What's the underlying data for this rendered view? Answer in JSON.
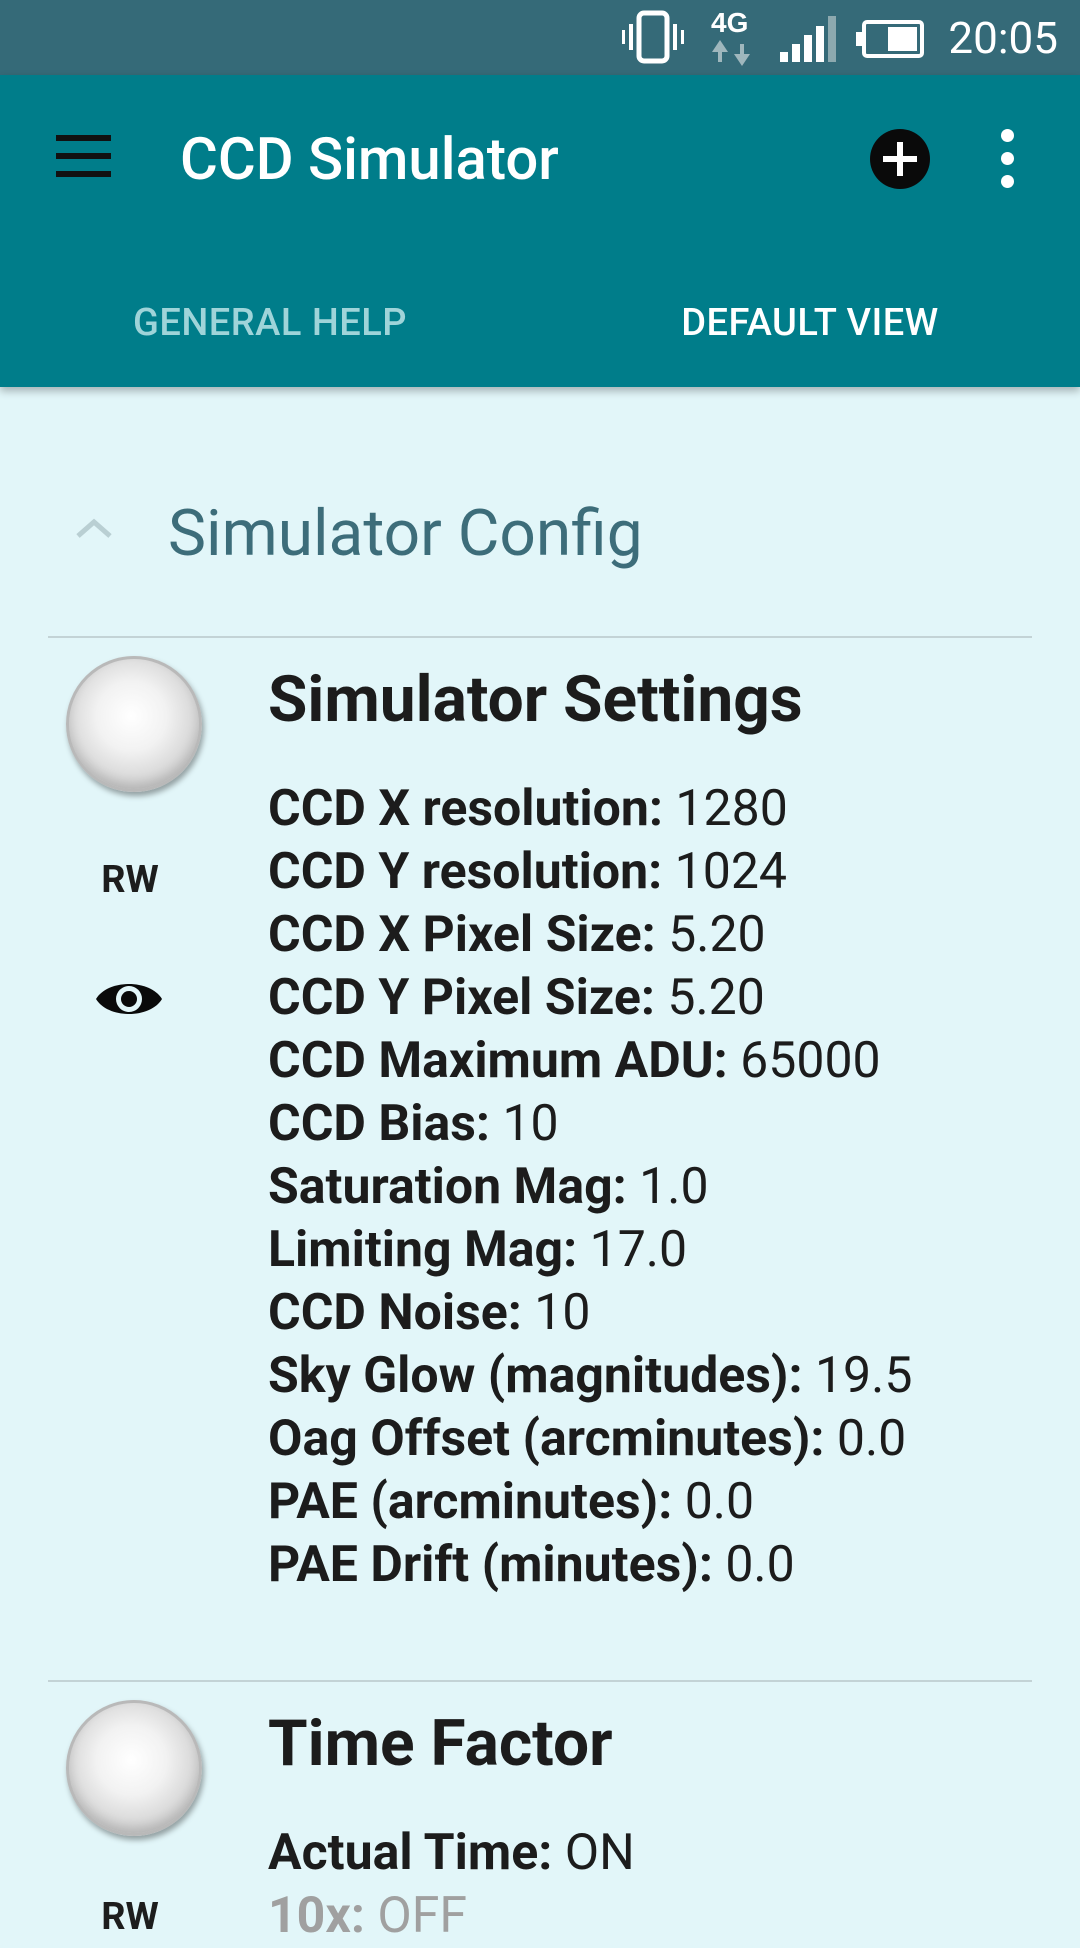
{
  "status_bar": {
    "time": "20:05",
    "network": "4G",
    "icons": [
      "vibrate-icon",
      "4g-data-icon",
      "signal-icon",
      "battery-icon"
    ]
  },
  "app_bar": {
    "title": "CCD Simulator",
    "actions": [
      "menu-icon",
      "add-circle-icon",
      "more-vert-icon"
    ],
    "tabs": [
      {
        "label": "GENERAL HELP",
        "selected": false
      },
      {
        "label": "DEFAULT VIEW",
        "selected": true
      }
    ]
  },
  "group": {
    "title": "Simulator Config",
    "expanded": true
  },
  "properties": [
    {
      "title": "Simulator Settings",
      "permission": "RW",
      "rows": [
        {
          "label": "CCD X resolution:",
          "value": "1280"
        },
        {
          "label": "CCD Y resolution:",
          "value": "1024"
        },
        {
          "label": "CCD X Pixel Size:",
          "value": "5.20"
        },
        {
          "label": "CCD Y Pixel Size:",
          "value": "5.20"
        },
        {
          "label": "CCD Maximum ADU:",
          "value": "65000"
        },
        {
          "label": "CCD Bias:",
          "value": "10"
        },
        {
          "label": "Saturation Mag:",
          "value": "1.0"
        },
        {
          "label": "Limiting Mag:",
          "value": "17.0"
        },
        {
          "label": "CCD Noise:",
          "value": "10"
        },
        {
          "label": "Sky Glow (magnitudes):",
          "value": "19.5"
        },
        {
          "label": "Oag Offset (arcminutes):",
          "value": "0.0"
        },
        {
          "label": "PAE (arcminutes):",
          "value": "0.0"
        },
        {
          "label": "PAE Drift (minutes):",
          "value": "0.0"
        }
      ]
    },
    {
      "title": "Time Factor",
      "permission": "RW",
      "rows": [
        {
          "label": "Actual Time:",
          "value": "ON"
        },
        {
          "label": "10x:",
          "value": "OFF"
        }
      ]
    }
  ],
  "colors": {
    "status_bar": "#356a78",
    "app_bar": "#007d8a",
    "background": "#e2f6f9",
    "group_title": "#3d6d7a",
    "tab_inactive": "#9fd4d9",
    "tab_active": "#ffffff"
  }
}
